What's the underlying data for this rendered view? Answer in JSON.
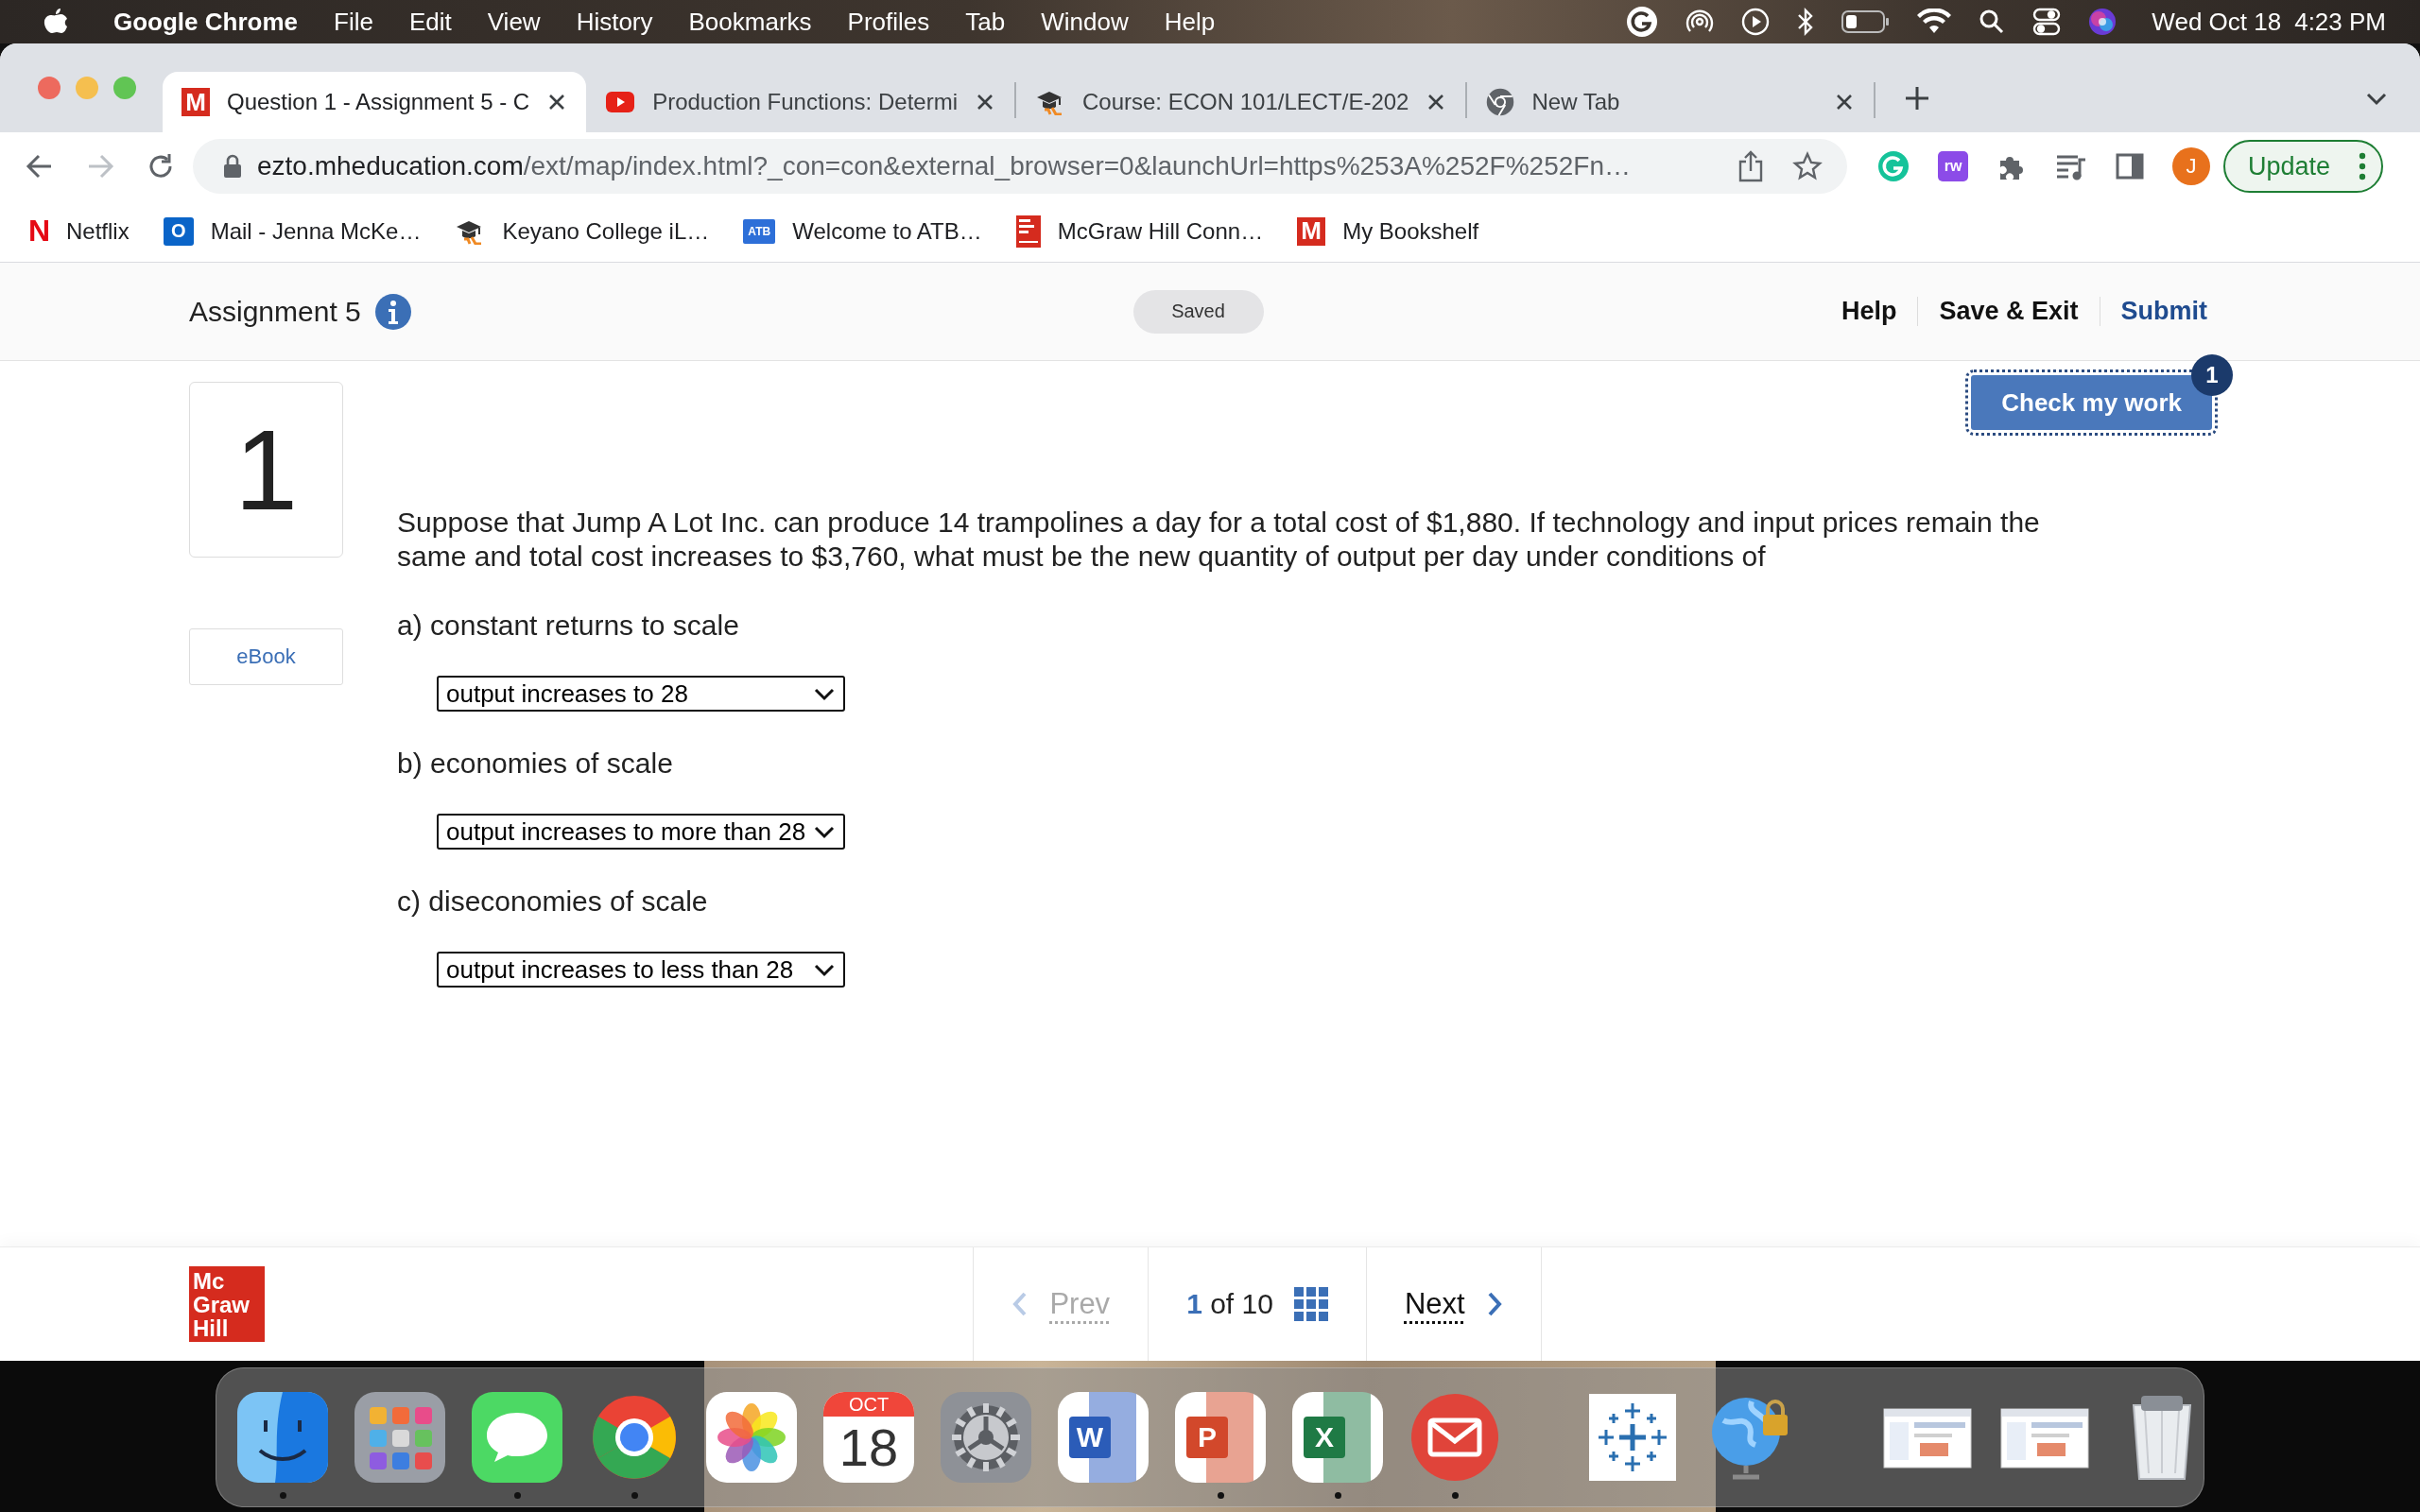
{
  "menu_bar": {
    "app_name": "Google Chrome",
    "menus": [
      "File",
      "Edit",
      "View",
      "History",
      "Bookmarks",
      "Profiles",
      "Tab",
      "Window",
      "Help"
    ],
    "date": "Wed Oct 18",
    "time": "4:23 PM"
  },
  "tabs": [
    {
      "title": "Question 1 - Assignment 5 - C",
      "kind": "tile",
      "icon_letter": "M",
      "selected": true
    },
    {
      "title": "Production Functions: Determi",
      "kind": "video",
      "selected": false
    },
    {
      "title": "Course: ECON 101/LECT/E-202",
      "kind": "hat",
      "selected": false
    },
    {
      "title": "New Tab",
      "kind": "browser",
      "selected": false
    }
  ],
  "address_bar": {
    "domain": "ezto.mheducation.com",
    "path": "/ext/map/index.html?_con=con&external_browser=0&launchUrl=https%253A%252F%252Fn…"
  },
  "extension_label": "rw",
  "profile_initial": "J",
  "update_button": "Update",
  "bookmarks": [
    {
      "title": "Netflix",
      "kind": "letter",
      "icon_letter": "N"
    },
    {
      "title": "Mail - Jenna McKe…",
      "kind": "mail",
      "icon_letter": "O"
    },
    {
      "title": "Keyano College iL…",
      "kind": "hat"
    },
    {
      "title": "Welcome to ATB…",
      "kind": "badge",
      "icon_letter": "ATB"
    },
    {
      "title": "McGraw Hill Conn…",
      "kind": "logo"
    },
    {
      "title": "My Bookshelf",
      "kind": "tile",
      "icon_letter": "M"
    }
  ],
  "assignment": {
    "title": "Assignment 5",
    "save_status": "Saved",
    "links": [
      {
        "label": "Help",
        "kind": "plain"
      },
      {
        "label": "Save & Exit",
        "kind": "plain"
      },
      {
        "label": "Submit",
        "kind": "primary"
      }
    ]
  },
  "question": {
    "number": "1",
    "ebook": "eBook",
    "check_button": "Check my work",
    "check_badge": "1",
    "text": "Suppose that Jump A Lot Inc. can produce 14 trampolines a day for a total cost of $1,880. If technology and input prices remain the same and total cost increases to $3,760, what must be the new quantity of output per day under conditions of",
    "parts": [
      {
        "label": "a) constant returns to scale",
        "answer": "output increases to 28"
      },
      {
        "label": "b) economies of scale",
        "answer": "output increases to more than 28"
      },
      {
        "label": "c) diseconomies of scale",
        "answer": "output increases to less than 28"
      }
    ]
  },
  "footer": {
    "logo_lines": [
      "Mc",
      "Graw",
      "Hill"
    ],
    "prev": {
      "label": "Prev",
      "disabled": true
    },
    "page": "1",
    "of": "of",
    "total": "10",
    "next": {
      "label": "Next",
      "disabled": false
    }
  },
  "dock": {
    "items": [
      {
        "kind": "finder",
        "running": true
      },
      {
        "kind": "launchpad",
        "running": false
      },
      {
        "kind": "messages",
        "running": true
      },
      {
        "kind": "browser",
        "running": true
      },
      {
        "kind": "photos",
        "running": false
      },
      {
        "kind": "calendar",
        "month": "OCT",
        "day": "18",
        "running": false
      },
      {
        "kind": "settings",
        "running": false
      },
      {
        "kind": "document",
        "letter": "W",
        "running": false
      },
      {
        "kind": "slides",
        "letter": "P",
        "running": true
      },
      {
        "kind": "spreadsheet",
        "letter": "X",
        "running": true
      },
      {
        "kind": "mail",
        "running": true
      },
      {
        "kind": "separator"
      },
      {
        "kind": "crosses",
        "running": false
      },
      {
        "kind": "globe",
        "running": false
      },
      {
        "kind": "separator"
      },
      {
        "kind": "thumbnail",
        "running": false
      },
      {
        "kind": "thumbnail",
        "running": false
      },
      {
        "kind": "trash",
        "running": false
      }
    ]
  }
}
